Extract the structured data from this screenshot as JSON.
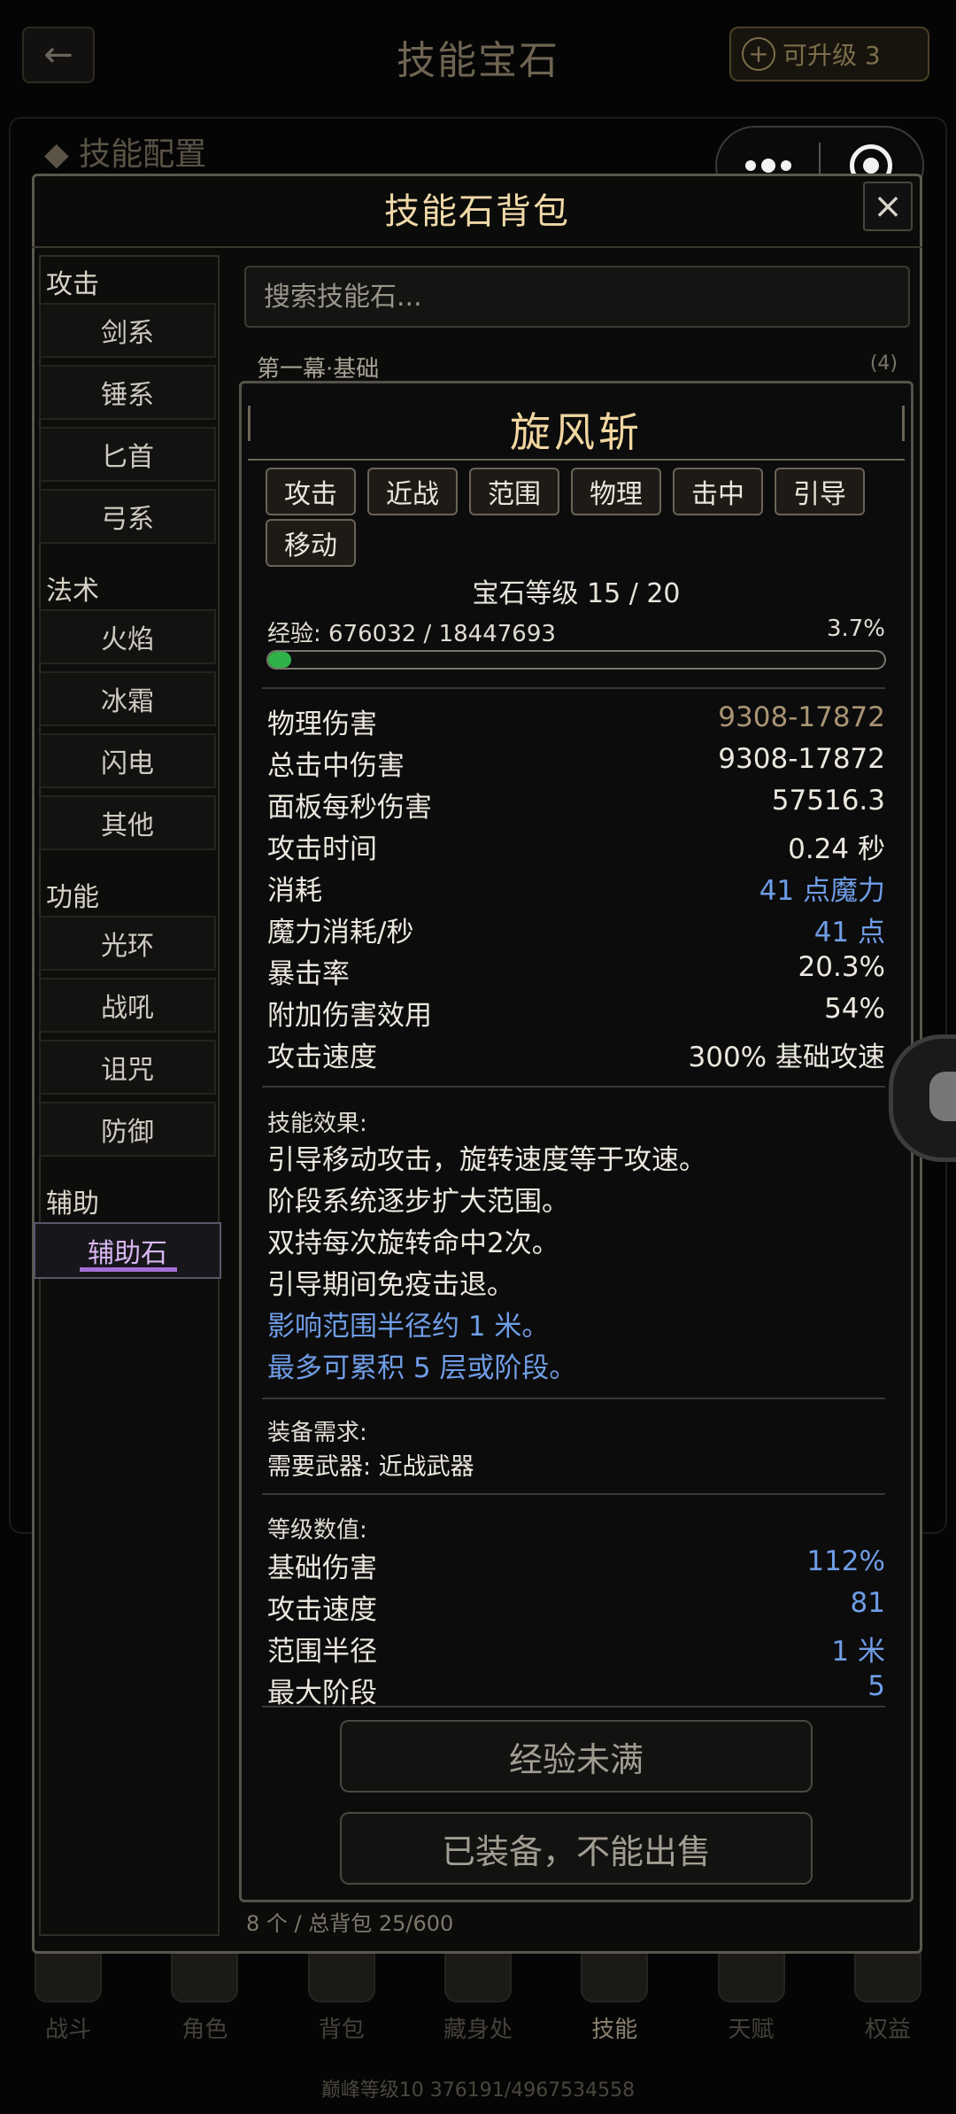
{
  "background": {
    "title": "技能宝石",
    "back_icon": "←",
    "upgrade_label": "可升级 3",
    "section_title": "◆ 技能配置",
    "nav": [
      {
        "label": "战斗"
      },
      {
        "label": "角色"
      },
      {
        "label": "背包"
      },
      {
        "label": "藏身处"
      },
      {
        "label": "技能"
      },
      {
        "label": "天赋"
      },
      {
        "label": "权益"
      }
    ],
    "footer": "巅峰等级10  376191/4967534558"
  },
  "bag": {
    "title": "技能石背包",
    "close_icon": "×",
    "search_placeholder": "搜索技能石...",
    "chapter_label": "第一幕·基础",
    "chapter_count": "(4)",
    "footer": "8 个 / 总背包 25/600",
    "categories": [
      {
        "group": "攻击",
        "items": [
          "剑系",
          "锤系",
          "匕首",
          "弓系"
        ]
      },
      {
        "group": "法术",
        "items": [
          "火焰",
          "冰霜",
          "闪电",
          "其他"
        ]
      },
      {
        "group": "功能",
        "items": [
          "光环",
          "战吼",
          "诅咒",
          "防御"
        ]
      },
      {
        "group": "辅助",
        "items": [
          "辅助石"
        ]
      }
    ]
  },
  "gem": {
    "name": "旋风斩",
    "tags": [
      "攻击",
      "近战",
      "范围",
      "物理",
      "击中",
      "引导",
      "移动"
    ],
    "level_text": "宝石等级 15 / 20",
    "exp_text": "经验: 676032 / 18447693",
    "exp_pct_text": "3.7%",
    "exp_fraction": 0.037,
    "stats": [
      {
        "label": "物理伤害",
        "value": "9308-17872"
      },
      {
        "label": "总击中伤害",
        "value": "9308-17872"
      },
      {
        "label": "面板每秒伤害",
        "value": "57516.3"
      },
      {
        "label": "攻击时间",
        "value": "0.24 秒"
      },
      {
        "label": "消耗",
        "value": "41 点魔力"
      },
      {
        "label": "魔力消耗/秒",
        "value": "41 点"
      },
      {
        "label": "暴击率",
        "value": "20.3%"
      },
      {
        "label": "附加伤害效用",
        "value": "54%"
      },
      {
        "label": "攻击速度",
        "value": "300% 基础攻速"
      }
    ],
    "effect_head": "技能效果:",
    "effects": [
      "引导移动攻击，旋转速度等于攻速。",
      "阶段系统逐步扩大范围。",
      "双持每次旋转命中2次。",
      "引导期间免疫击退。",
      "影响范围半径约 1 米。",
      "最多可累积 5 层或阶段。"
    ],
    "req_head": "装备需求:",
    "req_line": "需要武器: 近战武器",
    "level_head": "等级数值:",
    "level_stats": [
      {
        "label": "基础伤害",
        "value": "112%"
      },
      {
        "label": "攻击速度",
        "value": "81"
      },
      {
        "label": "范围半径",
        "value": "1 米"
      },
      {
        "label": "最大阶段",
        "value": "5"
      }
    ],
    "btn_exp": "经验未满",
    "btn_sell": "已装备，不能出售"
  },
  "colors": {
    "gold_title": "#f1d6a0",
    "blue_value": "#6f9de6",
    "gold_value": "#a99473",
    "exp_green": "#2fb24a",
    "selected_purple": "#a46fd6"
  }
}
